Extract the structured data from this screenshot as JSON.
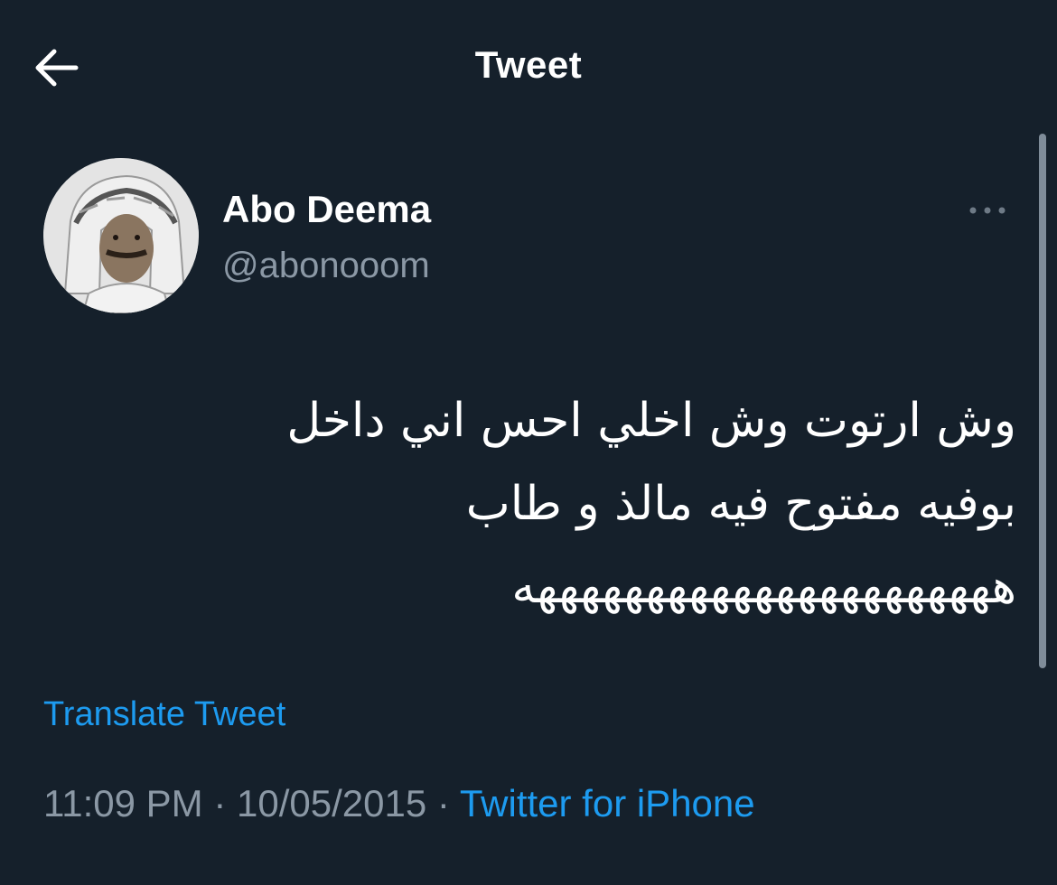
{
  "header": {
    "title": "Tweet",
    "back_icon": "arrow-left-icon"
  },
  "tweet": {
    "author": {
      "display_name": "Abo Deema",
      "handle": "@abonooom"
    },
    "more_icon": "more-horizontal-icon",
    "text": "وش ارتوت وش اخلي احس اني داخل\nبوفيه مفتوح فيه مالذ و طاب\nههههههههههههههههههههههه",
    "translate_label": "Translate Tweet",
    "time": "11:09 PM",
    "date": "10/05/2015",
    "source": "Twitter for iPhone",
    "separator": "·"
  },
  "colors": {
    "background": "#15202b",
    "primary_text": "#ffffff",
    "secondary_text": "#8b98a5",
    "link": "#1d9bf0"
  }
}
